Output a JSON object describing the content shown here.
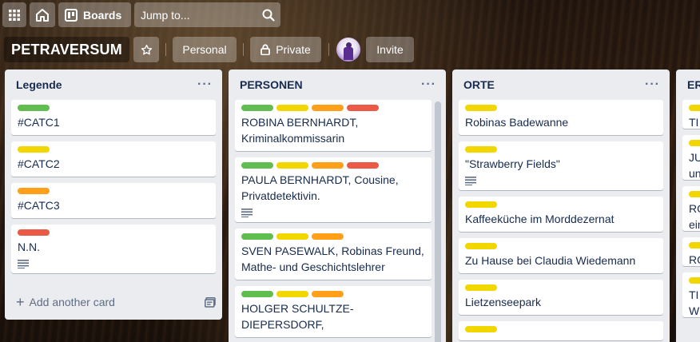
{
  "topbar": {
    "boards_label": "Boards",
    "search_placeholder": "Jump to..."
  },
  "board": {
    "title": "PETRAVERSUM",
    "visibility_team": "Personal",
    "visibility": "Private",
    "invite_label": "Invite"
  },
  "colors": {
    "green": "#61bd4f",
    "yellow": "#f2d600",
    "orange": "#ff9f1a",
    "red": "#eb5a46"
  },
  "lists": [
    {
      "title": "Legende",
      "cards": [
        {
          "labels": [
            "green"
          ],
          "text": "#CATC1",
          "description": false
        },
        {
          "labels": [
            "yellow"
          ],
          "text": "#CATC2",
          "description": false
        },
        {
          "labels": [
            "orange"
          ],
          "text": "#CATC3",
          "description": false
        },
        {
          "labels": [
            "red"
          ],
          "text": "N.N.",
          "description": true
        }
      ],
      "add_card_label": "Add another card"
    },
    {
      "title": "PERSONEN",
      "cards": [
        {
          "labels": [
            "green",
            "yellow",
            "orange",
            "red"
          ],
          "text": "ROBINA BERNHARDT, Kriminalkommissarin",
          "description": false
        },
        {
          "labels": [
            "green",
            "yellow",
            "orange",
            "red"
          ],
          "text": "PAULA BERNHARDT, Cousine, Privatdetektivin.",
          "description": true
        },
        {
          "labels": [
            "green",
            "yellow",
            "orange"
          ],
          "text": "SVEN PASEWALK, Robinas Freund, Mathe- und Geschichtslehrer",
          "description": false
        },
        {
          "labels": [
            "green",
            "yellow",
            "orange"
          ],
          "text": "HOLGER SCHULTZE-DIEPERSDORF,",
          "description": false
        }
      ]
    },
    {
      "title": "ORTE",
      "cards": [
        {
          "labels": [
            "yellow"
          ],
          "text": "Robinas Badewanne",
          "description": false
        },
        {
          "labels": [
            "yellow"
          ],
          "text": "\"Strawberry Fields\"",
          "description": true
        },
        {
          "labels": [
            "yellow"
          ],
          "text": "Kaffeeküche im Morddezernat",
          "description": false
        },
        {
          "labels": [
            "yellow"
          ],
          "text": "Zu Hause bei Claudia Wiedemann",
          "description": false
        },
        {
          "labels": [
            "yellow"
          ],
          "text": "Lietzenseepark",
          "description": false
        },
        {
          "labels": [
            "yellow"
          ],
          "text": "",
          "description": false
        }
      ]
    },
    {
      "title": "ER",
      "cards": [
        {
          "labels": [
            "yellow"
          ],
          "text": "TI"
        },
        {
          "labels": [
            "yellow"
          ],
          "text": "JU",
          "text2": "un"
        },
        {
          "labels": [
            "yellow"
          ],
          "text": "RO",
          "text2": "ein"
        },
        {
          "labels": [
            "yellow"
          ],
          "text": "RO"
        },
        {
          "labels": [
            "yellow"
          ],
          "text": "TI",
          "text2": "W"
        }
      ]
    }
  ]
}
